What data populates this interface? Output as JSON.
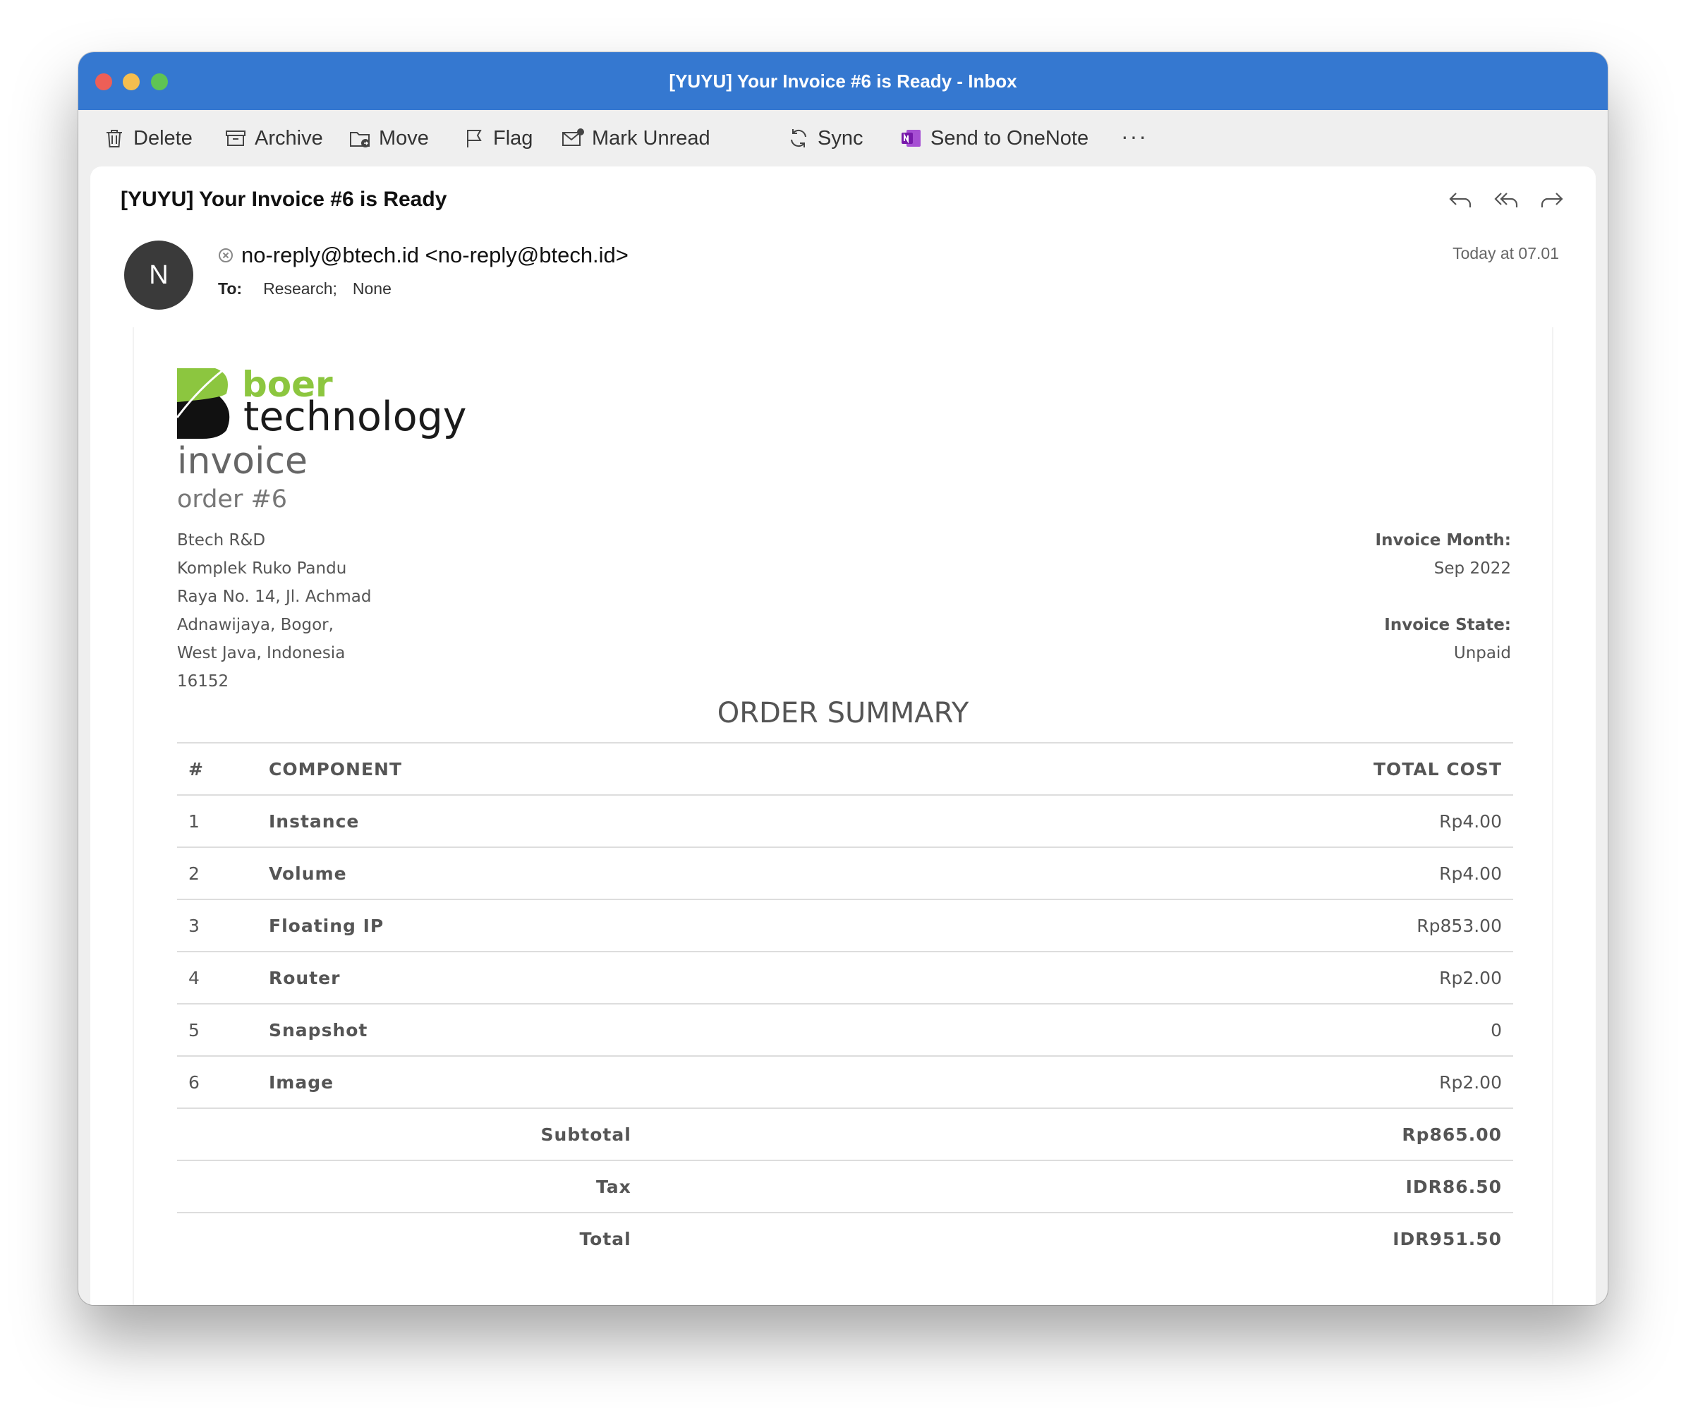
{
  "window": {
    "title": "[YUYU] Your Invoice #6 is Ready - Inbox",
    "accent_color": "#3578d0"
  },
  "toolbar": {
    "delete": "Delete",
    "archive": "Archive",
    "move": "Move",
    "flag": "Flag",
    "mark_unread": "Mark Unread",
    "sync": "Sync",
    "onenote": "Send to OneNote",
    "more": "···"
  },
  "message": {
    "subject": "[YUYU] Your Invoice #6 is Ready",
    "avatar_letter": "N",
    "sender": "no-reply@btech.id <no-reply@btech.id>",
    "to_label": "To:",
    "to_recipients": [
      "Research;",
      "None"
    ],
    "date": "Today at 07.01"
  },
  "invoice": {
    "logo_word1": "boer",
    "logo_word2": "technology",
    "logo_color": "#8cc63f",
    "title": "invoice",
    "order": "order #6",
    "address": [
      "Btech R&D",
      "Komplek Ruko Pandu",
      "Raya No. 14, Jl. Achmad",
      "Adnawijaya, Bogor,",
      "West Java, Indonesia",
      "16152"
    ],
    "month_label": "Invoice Month:",
    "month_value": "Sep 2022",
    "state_label": "Invoice State:",
    "state_value": "Unpaid",
    "summary_title": "ORDER SUMMARY",
    "columns": [
      "#",
      "COMPONENT",
      "TOTAL COST"
    ],
    "rows": [
      {
        "num": "1",
        "component": "Instance",
        "cost": "Rp4.00"
      },
      {
        "num": "2",
        "component": "Volume",
        "cost": "Rp4.00"
      },
      {
        "num": "3",
        "component": "Floating IP",
        "cost": "Rp853.00"
      },
      {
        "num": "4",
        "component": "Router",
        "cost": "Rp2.00"
      },
      {
        "num": "5",
        "component": "Snapshot",
        "cost": "0"
      },
      {
        "num": "6",
        "component": "Image",
        "cost": "Rp2.00"
      }
    ],
    "subtotal_label": "Subtotal",
    "subtotal_value": "Rp865.00",
    "tax_label": "Tax",
    "tax_value": "IDR86.50",
    "total_label": "Total",
    "total_value": "IDR951.50"
  }
}
